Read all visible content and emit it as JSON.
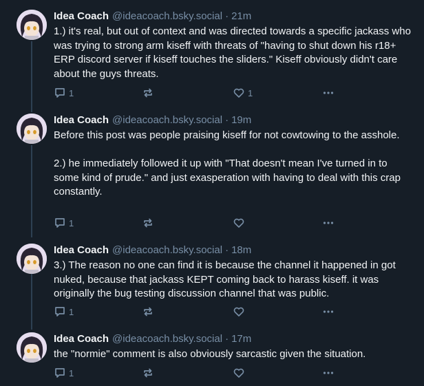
{
  "posts": [
    {
      "author": "Idea Coach",
      "handle": "@ideacoach.bsky.social",
      "separator": "·",
      "time": "21m",
      "text": "1.) it's real, but out of context and was directed towards a specific jackass who was trying to strong arm kiseff with threats of \"having to shut down his r18+ ERP discord server if kiseff touches the sliders.\" Kiseff obviously didn't care about the guys threats.",
      "replies": "1",
      "likes": "1"
    },
    {
      "author": "Idea Coach",
      "handle": "@ideacoach.bsky.social",
      "separator": "·",
      "time": "19m",
      "text": "Before this post was people praising kiseff for not cowtowing to the asshole.\n\n2.) he immediately followed it up with \"That doesn't mean I've turned in to some kind of prude.\" and just exasperation with having to deal with this crap constantly.",
      "replies": "1",
      "likes": ""
    },
    {
      "author": "Idea Coach",
      "handle": "@ideacoach.bsky.social",
      "separator": "·",
      "time": "18m",
      "text": "3.) The reason no one can find it is because the channel it happened in got nuked, because that jackass KEPT coming back to harass kiseff. it was originally the bug testing discussion channel that was public.",
      "replies": "1",
      "likes": ""
    },
    {
      "author": "Idea Coach",
      "handle": "@ideacoach.bsky.social",
      "separator": "·",
      "time": "17m",
      "text": "the \"normie\" comment is also obviously sarcastic given the situation.",
      "replies": "1",
      "likes": ""
    }
  ],
  "icons": {
    "reply": "reply-icon",
    "repost": "repost-icon",
    "like": "heart-icon",
    "more": "more-icon"
  },
  "colors": {
    "background": "#161e27",
    "text": "#f1f3f5",
    "muted": "#788ea5",
    "thread_line": "#2e4052"
  }
}
